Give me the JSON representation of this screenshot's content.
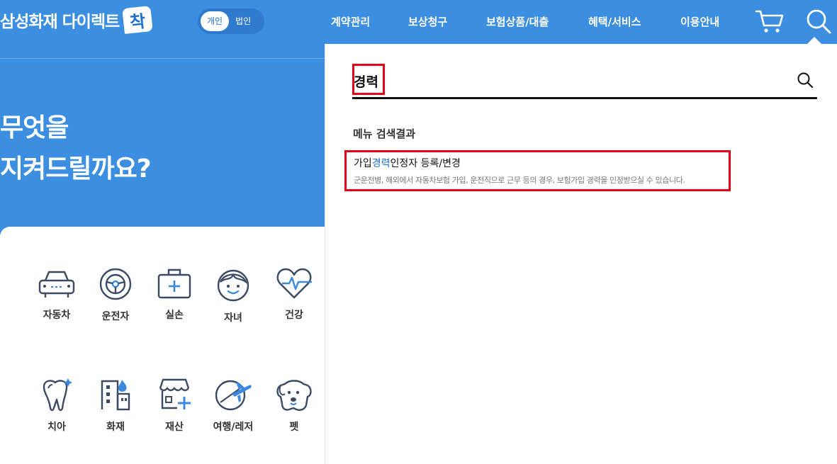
{
  "header": {
    "logo_text": "삼성화재 다이렉트",
    "logo_badge": "착",
    "segment": [
      "개인",
      "법인"
    ],
    "nav": [
      "계약관리",
      "보상청구",
      "보험상품/대출",
      "혜택/서비스",
      "이용안내"
    ],
    "icons": [
      "cart-icon",
      "search-icon"
    ]
  },
  "hero": {
    "title_line1": "무엇을",
    "title_line2": "지켜드릴까요?"
  },
  "products": [
    "자동차",
    "운전자",
    "실손",
    "자녀",
    "건강",
    "치아",
    "화재",
    "재산",
    "여행/레저",
    "펫"
  ],
  "search": {
    "query": "경력",
    "results_heading": "메뉴 검색결과",
    "result": {
      "title_before": "가입",
      "title_match": "경력",
      "title_after": "인정자 등록/변경",
      "description": "군운전병, 해외에서 자동차보험 가입, 운전직으로 근무 등의 경우, 보험가입 경력을 인정받으실 수 있습니다."
    }
  },
  "colors": {
    "primary_blue": "#3b8ee0",
    "highlight_red": "#e4001b",
    "match_blue": "#1f6fcf"
  }
}
